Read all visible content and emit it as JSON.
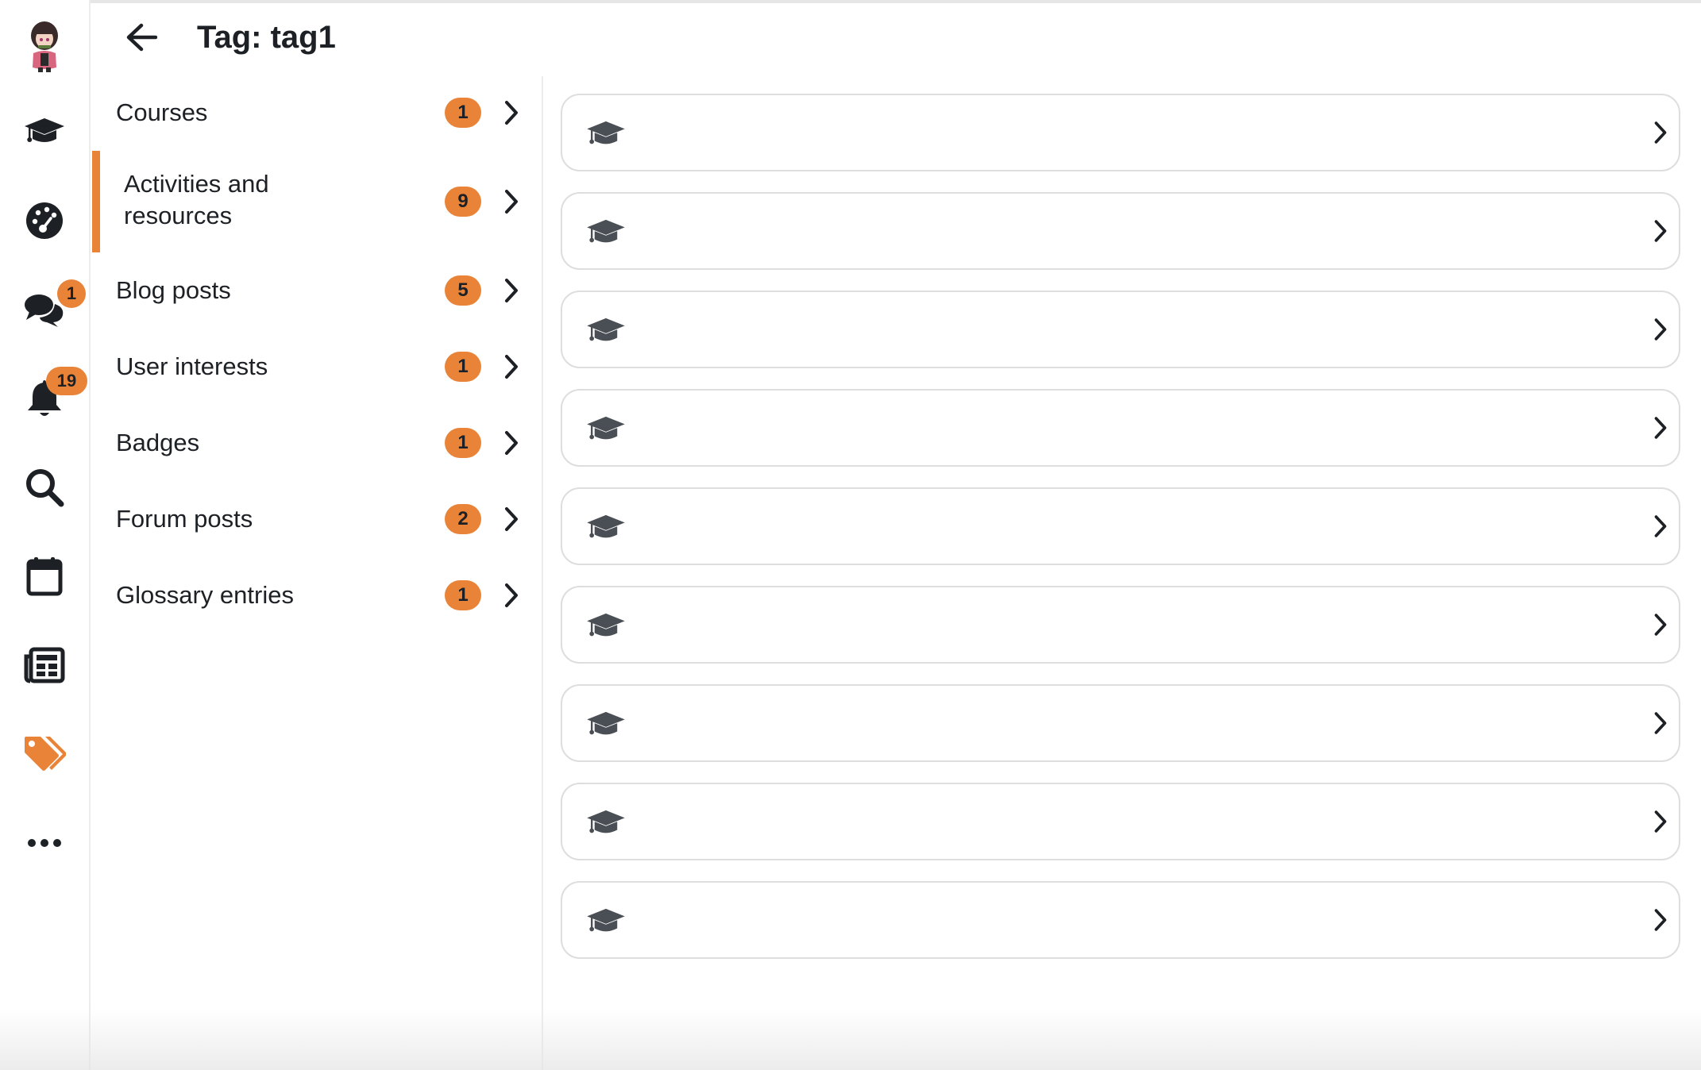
{
  "header": {
    "title": "Tag: tag1",
    "back_icon": "arrow-left-icon"
  },
  "rail": {
    "items": [
      {
        "name": "avatar",
        "icon": "user-avatar"
      },
      {
        "name": "rail-courses",
        "icon": "graduation-cap-icon"
      },
      {
        "name": "rail-dashboard",
        "icon": "dashboard-gauge-icon"
      },
      {
        "name": "rail-messages",
        "icon": "chat-bubbles-icon",
        "badge": "1"
      },
      {
        "name": "rail-notifications",
        "icon": "bell-icon",
        "badge": "19"
      },
      {
        "name": "rail-search",
        "icon": "search-icon"
      },
      {
        "name": "rail-calendar",
        "icon": "calendar-icon"
      },
      {
        "name": "rail-news",
        "icon": "newspaper-icon"
      },
      {
        "name": "rail-tags",
        "icon": "tags-icon",
        "active": true
      },
      {
        "name": "rail-more",
        "icon": "ellipsis-icon"
      }
    ]
  },
  "menu": {
    "items": [
      {
        "label": "Courses",
        "count": "1"
      },
      {
        "label": "Activities and resources",
        "count": "9",
        "active": true
      },
      {
        "label": "Blog posts",
        "count": "5"
      },
      {
        "label": "User interests",
        "count": "1"
      },
      {
        "label": "Badges",
        "count": "1"
      },
      {
        "label": "Forum posts",
        "count": "2"
      },
      {
        "label": "Glossary entries",
        "count": "1"
      }
    ]
  },
  "results": {
    "row_count": 9,
    "row_icon": "graduation-cap-icon",
    "row_action_icon": "chevron-right-icon"
  },
  "colors": {
    "accent": "#e98338",
    "text": "#1d2125",
    "icon": "#4a4f55",
    "border": "#dedede"
  }
}
